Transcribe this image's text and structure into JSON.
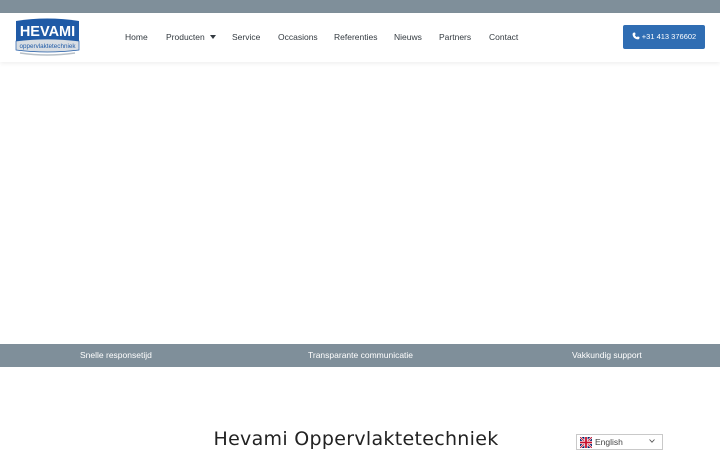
{
  "brand": {
    "logo_name": "HEVAMI",
    "logo_tagline": "oppervlaktetechniek"
  },
  "nav": {
    "items": [
      {
        "label": "Home"
      },
      {
        "label": "Producten",
        "has_dropdown": true
      },
      {
        "label": "Service"
      },
      {
        "label": "Occasions"
      },
      {
        "label": "Referenties"
      },
      {
        "label": "Nieuws"
      },
      {
        "label": "Partners"
      },
      {
        "label": "Contact"
      }
    ]
  },
  "header": {
    "phone_label": "+31 413 376602",
    "phone_icon": "phone-icon"
  },
  "features": [
    {
      "label": "Snelle responsetijd"
    },
    {
      "label": "Transparante communicatie"
    },
    {
      "label": "Vakkundig support"
    }
  ],
  "main": {
    "title": "Hevami Oppervlaktetechniek"
  },
  "language": {
    "selected": "English",
    "flag_icon": "uk-flag-icon",
    "dropdown_icon": "chevron-down-icon"
  },
  "colors": {
    "accent": "#2f6db3",
    "bar": "#7f8f9a",
    "logo_blue": "#1f5aa6"
  }
}
